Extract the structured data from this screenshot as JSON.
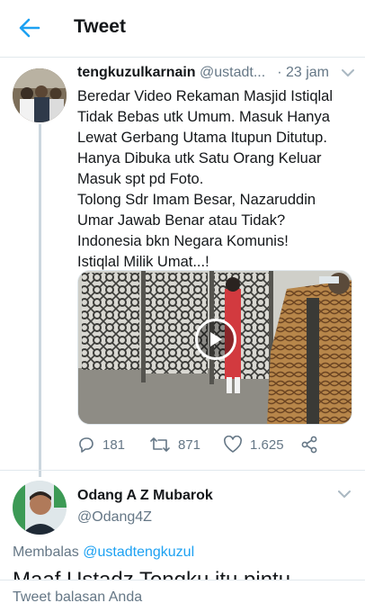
{
  "header": {
    "title": "Tweet",
    "back_icon": "arrow-left-icon"
  },
  "colors": {
    "accent": "#1da1f2",
    "text": "#14171a",
    "secondary": "#657786",
    "border": "#e1e8ed"
  },
  "tweet": {
    "name": "tengkuzulkarnain",
    "handle": "@ustadt...",
    "dot": "·",
    "time": "23 jam",
    "lines": [
      "Beredar Video Rekaman Masjid Istiqlal",
      "Tidak Bebas utk Umum. Masuk Hanya",
      "Lewat Gerbang Utama Itupun Ditutup.",
      "Hanya Dibuka utk Satu Orang Keluar",
      "Masuk spt pd Foto.",
      "Tolong Sdr Imam Besar, Nazaruddin",
      "Umar Jawab Benar atau Tidak?",
      "Indonesia bkn Negara Komunis!",
      "Istiqlal Milik Umat...!"
    ],
    "replies": "181",
    "retweets": "871",
    "likes": "1.625"
  },
  "reply": {
    "name": "Odang A Z Mubarok",
    "handle": "@Odang4Z",
    "replying_prefix": "Membalas ",
    "replying_mention": "@ustadtengkuzul",
    "text_peek": "Maaf Ustadz Tengku itu pintu"
  },
  "compose": {
    "placeholder": "Tweet balasan Anda"
  }
}
